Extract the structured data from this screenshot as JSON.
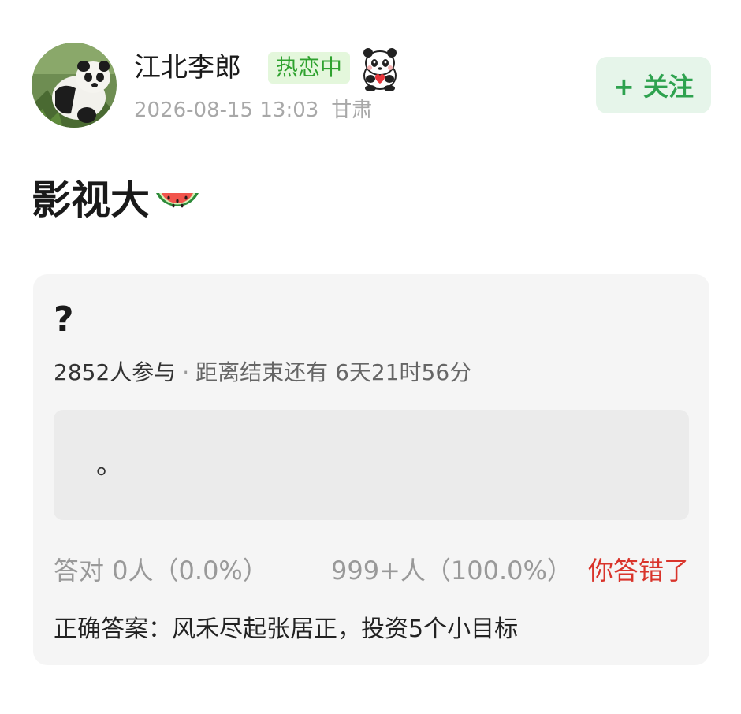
{
  "author": {
    "name": "江北李郎",
    "badge": "热恋中",
    "date": "2026-08-15 13:03",
    "location": "甘肃"
  },
  "follow_label": "+ 关注",
  "post": {
    "title": "影视大"
  },
  "quiz": {
    "question": "?",
    "participants": "2852人参与",
    "separator": "·",
    "countdown": "距离结束还有 6天21时56分",
    "option_text": "。",
    "correct_count": "答对 0人（0.0%）",
    "other_count": "999+人（100.0%）",
    "result": "你答错了",
    "answer_line": "正确答案：风禾尽起张居正，投资5个小目标"
  },
  "colors": {
    "badge_green": "#2fa22f",
    "follow_green": "#2ea24f",
    "wrong_red": "#d9342b"
  },
  "icons": {
    "badge_icon": "panda-holding-heart-icon",
    "title_emoji": "watermelon-icon"
  }
}
